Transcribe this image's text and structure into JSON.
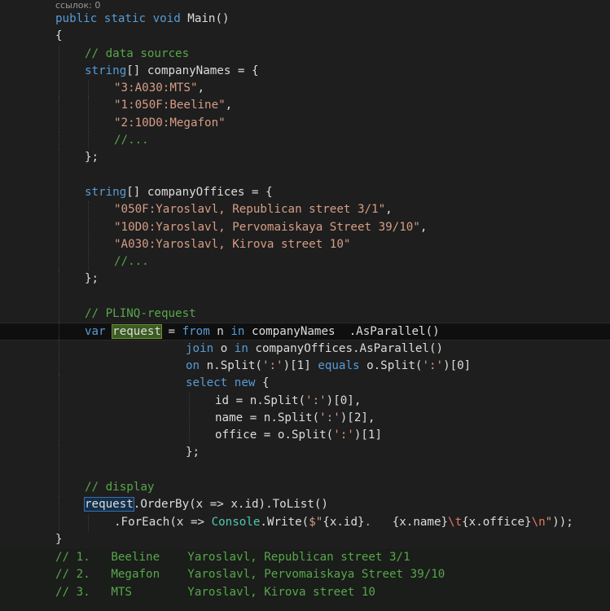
{
  "codelens": "ссылок: 0",
  "code": {
    "l01_a": "public",
    "l01_b": " ",
    "l01_c": "static",
    "l01_d": " ",
    "l01_e": "void",
    "l01_f": " Main()",
    "l02": "{",
    "l03": "// data sources",
    "l04_type": "string",
    "l04_rest": "[] companyNames = {",
    "l05": "\"3:A030:MTS\"",
    "l05_c": ",",
    "l06": "\"1:050F:Beeline\"",
    "l06_c": ",",
    "l07": "\"2:10D0:Megafon\"",
    "l08": "//...",
    "l09": "};",
    "l11_type": "string",
    "l11_rest": "[] companyOffices = {",
    "l12": "\"050F:Yaroslavl, Republican street 3/1\"",
    "l12_c": ",",
    "l13": "\"10D0:Yaroslavl, Pervomaiskaya Street 39/10\"",
    "l13_c": ",",
    "l14": "\"A030:Yaroslavl, Kirova street 10\"",
    "l15": "//...",
    "l16": "};",
    "l18": "// PLINQ-request",
    "l19_var": "var",
    "l19_req": "request",
    "l19_eq": " = ",
    "l19_from": "from",
    "l19_n": " n ",
    "l19_in": "in",
    "l19_rest": " companyNames  .AsParallel()",
    "l20_join": "join",
    "l20_o": " o ",
    "l20_in": "in",
    "l20_rest": " companyOffices.AsParallel()",
    "l21_on": "on",
    "l21_a": " n.Split(",
    "l21_s1": "':'",
    "l21_b": ")[1] ",
    "l21_eq": "equals",
    "l21_c": " o.Split(",
    "l21_s2": "':'",
    "l21_d": ")[0]",
    "l22_select": "select",
    "l22_sp": " ",
    "l22_new": "new",
    "l22_rest": " {",
    "l23_a": "id = n.Split(",
    "l23_s": "':'",
    "l23_b": ")[0],",
    "l24_a": "name = n.Split(",
    "l24_s": "':'",
    "l24_b": ")[2],",
    "l25_a": "office = o.Split(",
    "l25_s": "':'",
    "l25_b": ")[1]",
    "l26": "};",
    "l28": "// display",
    "l29_req": "request",
    "l29_rest": ".OrderBy(x => x.id).ToList()",
    "l30_a": ".ForEach(x => ",
    "l30_ty": "Console",
    "l30_b": ".Write(",
    "l30_s1": "$\"",
    "l30_i1": "{x.id}",
    "l30_s2": ".   ",
    "l30_i2": "{x.name}",
    "l30_e1": "\\t",
    "l30_i3": "{x.office}",
    "l30_e2": "\\n",
    "l30_s3": "\"",
    "l30_c": "));",
    "l31": "}",
    "l32": "// 1.   Beeline    Yaroslavl, Republican street 3/1",
    "l33": "// 2.   Megafon    Yaroslavl, Pervomaiskaya Street 39/10",
    "l34": "// 3.   MTS        Yaroslavl, Kirova street 10"
  },
  "colors": {
    "background": "#1e1e1e",
    "keyword": "#569cd6",
    "string": "#d69d85",
    "comment": "#57a64a",
    "type": "#4ec9b0",
    "text": "#dcdcdc"
  }
}
